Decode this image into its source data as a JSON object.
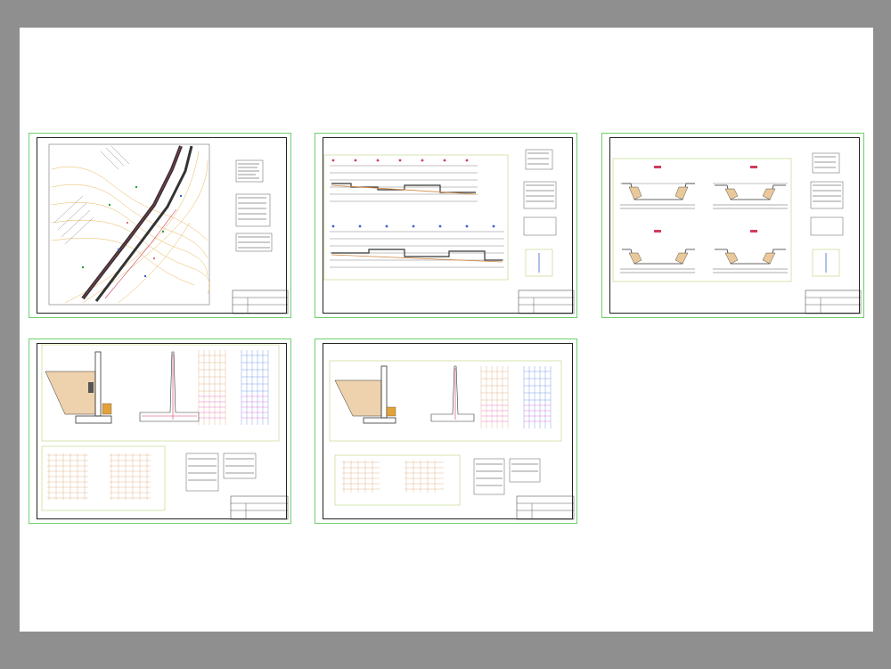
{
  "colors": {
    "background": "#8f8f8f",
    "canvas": "#ffffff",
    "sheet_border": "#6fd06f",
    "contour": "#e7b85a",
    "channel": "#d23c5a",
    "grid_orange": "#d79b64",
    "grid_magenta": "#e040c8",
    "grid_blue": "#4a7fe0",
    "terrain": "#e9c89a"
  },
  "sheets": [
    {
      "id": "sheet-plan",
      "kind": "plan"
    },
    {
      "id": "sheet-profile",
      "kind": "profile"
    },
    {
      "id": "sheet-sections",
      "kind": "sections"
    },
    {
      "id": "sheet-wall-1",
      "kind": "wall"
    },
    {
      "id": "sheet-wall-2",
      "kind": "wall"
    }
  ]
}
